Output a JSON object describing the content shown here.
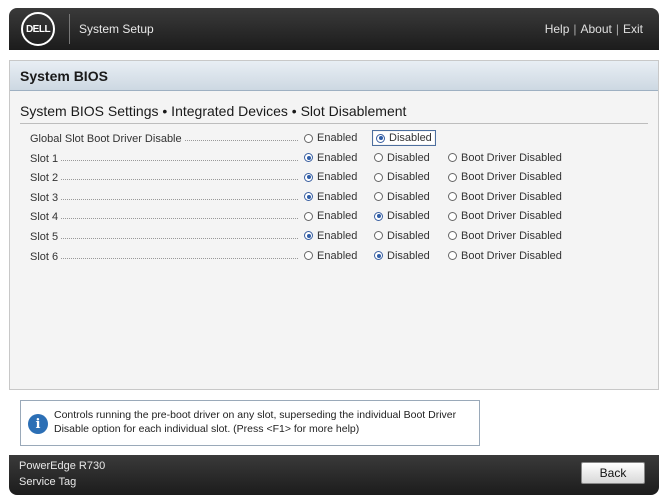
{
  "header": {
    "logo": "DELL",
    "title": "System Setup",
    "links": [
      "Help",
      "About",
      "Exit"
    ]
  },
  "section": {
    "title": "System BIOS"
  },
  "page": {
    "title": "System BIOS Settings • Integrated Devices • Slot Disablement"
  },
  "settings": [
    {
      "label": "Global Slot Boot Driver Disable",
      "options": [
        "Enabled",
        "Disabled"
      ],
      "selected": 1
    },
    {
      "label": "Slot 1",
      "options": [
        "Enabled",
        "Disabled",
        "Boot Driver Disabled"
      ],
      "selected": 0
    },
    {
      "label": "Slot 2",
      "options": [
        "Enabled",
        "Disabled",
        "Boot Driver Disabled"
      ],
      "selected": 0
    },
    {
      "label": "Slot 3",
      "options": [
        "Enabled",
        "Disabled",
        "Boot Driver Disabled"
      ],
      "selected": 0
    },
    {
      "label": "Slot 4",
      "options": [
        "Enabled",
        "Disabled",
        "Boot Driver Disabled"
      ],
      "selected": 1
    },
    {
      "label": "Slot 5",
      "options": [
        "Enabled",
        "Disabled",
        "Boot Driver Disabled"
      ],
      "selected": 0
    },
    {
      "label": "Slot 6",
      "options": [
        "Enabled",
        "Disabled",
        "Boot Driver Disabled"
      ],
      "selected": 1
    }
  ],
  "help": {
    "icon": "info-icon",
    "line1": "Controls running the pre-boot driver on any slot, superseding the individual Boot Driver",
    "line2": "Disable option for each individual slot. (Press <F1> for more help)"
  },
  "footer": {
    "model": "PowerEdge R730",
    "service_tag_label": "Service Tag",
    "back_label": "Back"
  },
  "colors": {
    "header_bg": "#2a2a2a",
    "section_bar": "#d6e0ea",
    "radio_on": "#2f5da8",
    "info_icon": "#2c6fb5"
  }
}
